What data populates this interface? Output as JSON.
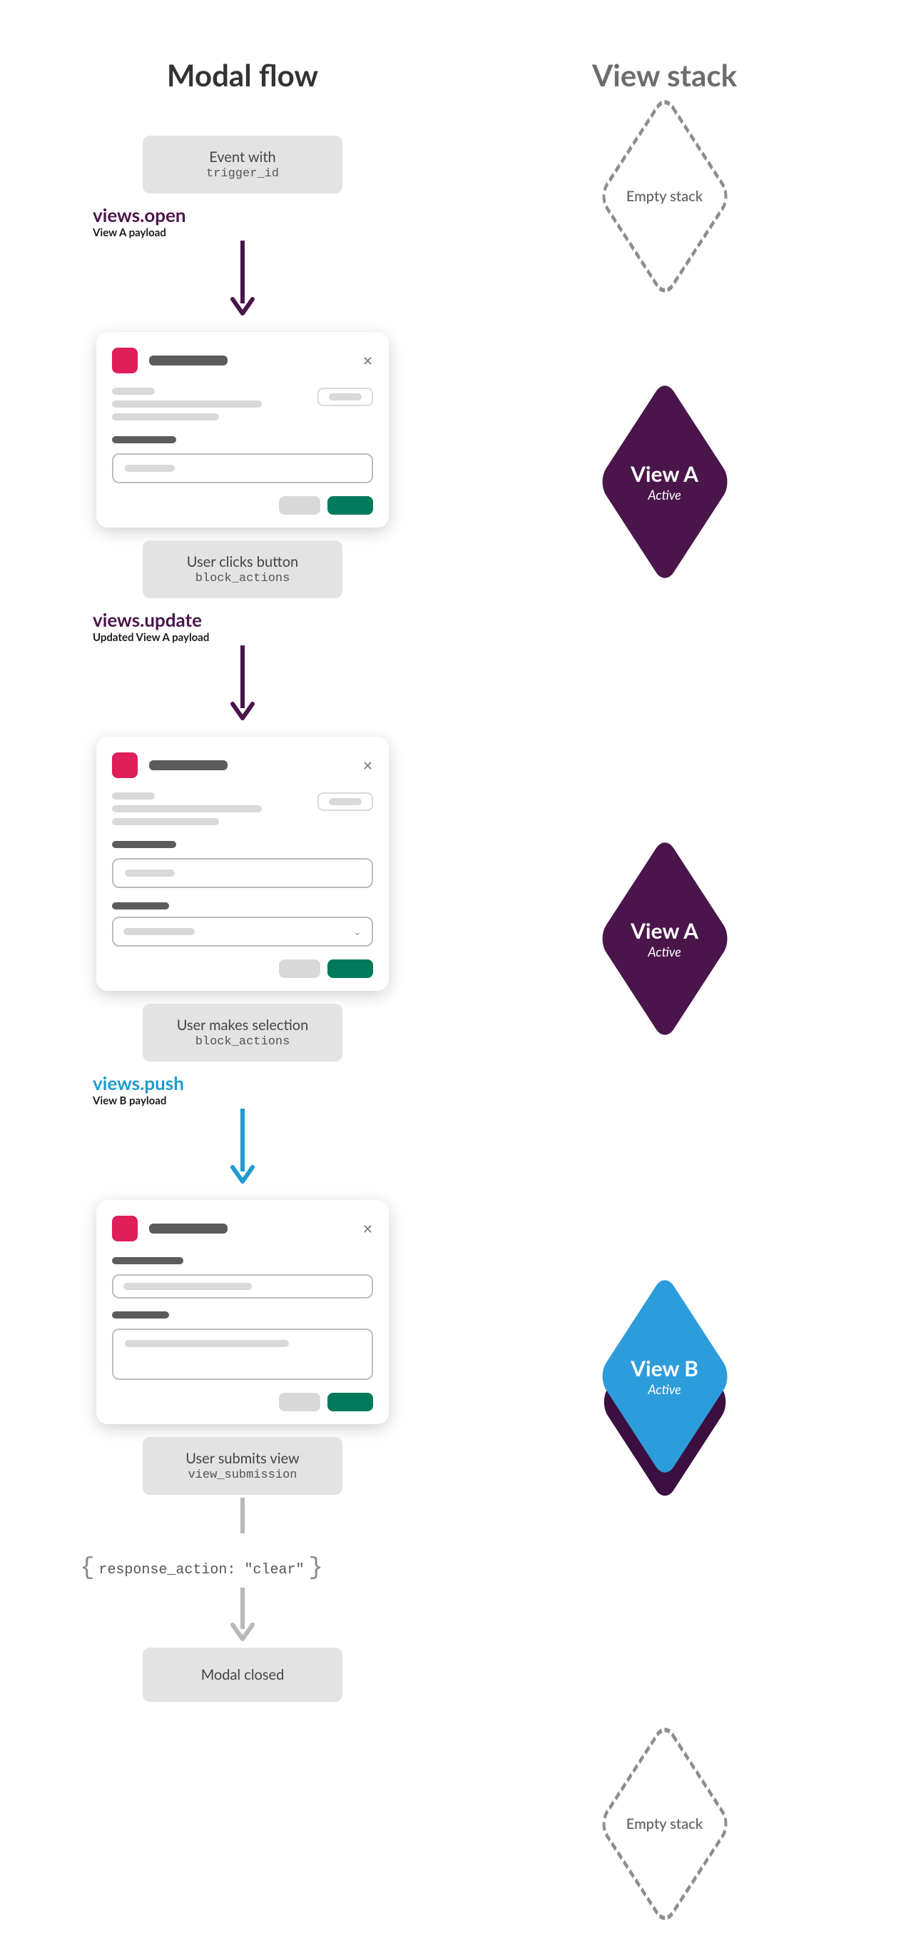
{
  "headings": {
    "left": "Modal flow",
    "right": "View stack"
  },
  "events": {
    "e1_title": "Event with",
    "e1_sub": "trigger_id",
    "e2_title": "User clicks button",
    "e2_sub": "block_actions",
    "e3_title": "User makes selection",
    "e3_sub": "block_actions",
    "e4_title": "User submits view",
    "e4_sub": "view_submission",
    "closed": "Modal closed"
  },
  "actions": {
    "a1_title": "views.open",
    "a1_sub": "View A payload",
    "a2_title": "views.update",
    "a2_sub": "Updated View A payload",
    "a3_title": "views.push",
    "a3_sub": "View B payload"
  },
  "response": {
    "text": "response_action: \"clear\""
  },
  "stack": {
    "empty": "Empty stack",
    "viewA_name": "View A",
    "viewA_state": "Active",
    "viewB_name": "View B",
    "viewB_state": "Active"
  },
  "colors": {
    "purple": "#4a154b",
    "blue": "#2d9cdb",
    "green": "#007a5a",
    "pink": "#e01e5a",
    "grey": "#8d8d8d"
  }
}
